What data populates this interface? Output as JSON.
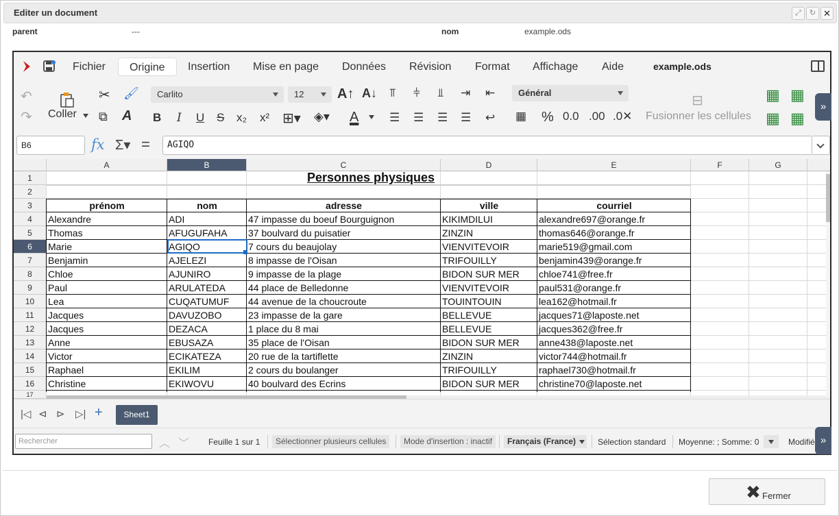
{
  "dialog": {
    "title": "Editer un document",
    "parent_label": "parent",
    "parent_value": "---",
    "nom_label": "nom",
    "nom_value": "example.ods",
    "close_button": "Fermer"
  },
  "menubar": {
    "items": [
      "Fichier",
      "Origine",
      "Insertion",
      "Mise en page",
      "Données",
      "Révision",
      "Format",
      "Affichage",
      "Aide"
    ],
    "active": "Origine",
    "document_name": "example.ods"
  },
  "toolbar": {
    "paste_label": "Coller",
    "font_name": "Carlito",
    "font_size": "12",
    "number_format": "Général",
    "merge_label": "Fusionner les cellules"
  },
  "formula": {
    "cell_ref": "B6",
    "value": "AGIQO"
  },
  "sheet": {
    "columns": [
      "A",
      "B",
      "C",
      "D",
      "E",
      "F",
      "G"
    ],
    "selected_column": "B",
    "selected_row": 6,
    "title": "Personnes physiques",
    "headers": [
      "prénom",
      "nom",
      "adresse",
      "ville",
      "courriel"
    ],
    "rows": [
      [
        "Alexandre",
        "ADI",
        "47 impasse du boeuf Bourguignon",
        "KIKIMDILUI",
        "alexandre697@orange.fr"
      ],
      [
        "Thomas",
        "AFUGUFAHA",
        "37 boulvard du puisatier",
        "ZINZIN",
        "thomas646@orange.fr"
      ],
      [
        "Marie",
        "AGIQO",
        "7 cours du beaujolay",
        "VIENVITEVOIR",
        "marie519@gmail.com"
      ],
      [
        "Benjamin",
        "AJELEZI",
        "8 impasse de l'Oisan",
        "TRIFOUILLY",
        "benjamin439@orange.fr"
      ],
      [
        "Chloe",
        "AJUNIRO",
        "9 impasse de la plage",
        "BIDON SUR MER",
        "chloe741@free.fr"
      ],
      [
        "Paul",
        "ARULATEDA",
        "44 place de Belledonne",
        "VIENVITEVOIR",
        "paul531@orange.fr"
      ],
      [
        "Lea",
        "CUQATUMUF",
        "44 avenue de la choucroute",
        "TOUINTOUIN",
        "lea162@hotmail.fr"
      ],
      [
        "Jacques",
        "DAVUZOBO",
        "23 impasse de la gare",
        "BELLEVUE",
        "jacques71@laposte.net"
      ],
      [
        "Jacques",
        "DEZACA",
        "1 place du 8 mai",
        "BELLEVUE",
        "jacques362@free.fr"
      ],
      [
        "Anne",
        "EBUSAZA",
        "35 place de l'Oisan",
        "BIDON SUR MER",
        "anne438@laposte.net"
      ],
      [
        "Victor",
        "ECIKATEZA",
        "20 rue de la tartiflette",
        "ZINZIN",
        "victor744@hotmail.fr"
      ],
      [
        "Raphael",
        "EKILIM",
        "2 cours du boulanger",
        "TRIFOUILLY",
        "raphael730@hotmail.fr"
      ],
      [
        "Christine",
        "EKIWOVU",
        "40 boulvard des Ecrins",
        "BIDON SUR MER",
        "christine70@laposte.net"
      ]
    ],
    "tab_name": "Sheet1"
  },
  "statusbar": {
    "search_placeholder": "Rechercher",
    "sheet_count": "Feuille 1 sur 1",
    "multi_select": "Sélectionner plusieurs cellules",
    "insert_mode": "Mode d'insertion : inactif",
    "language": "Français (France)",
    "selection_mode": "Sélection standard",
    "summary": "Moyenne: ; Somme: 0",
    "modified": "Modifié"
  },
  "colors": {
    "selection": "#1e6cc4",
    "header_selected": "#4b5a70",
    "fx": "#4a8fd1"
  }
}
